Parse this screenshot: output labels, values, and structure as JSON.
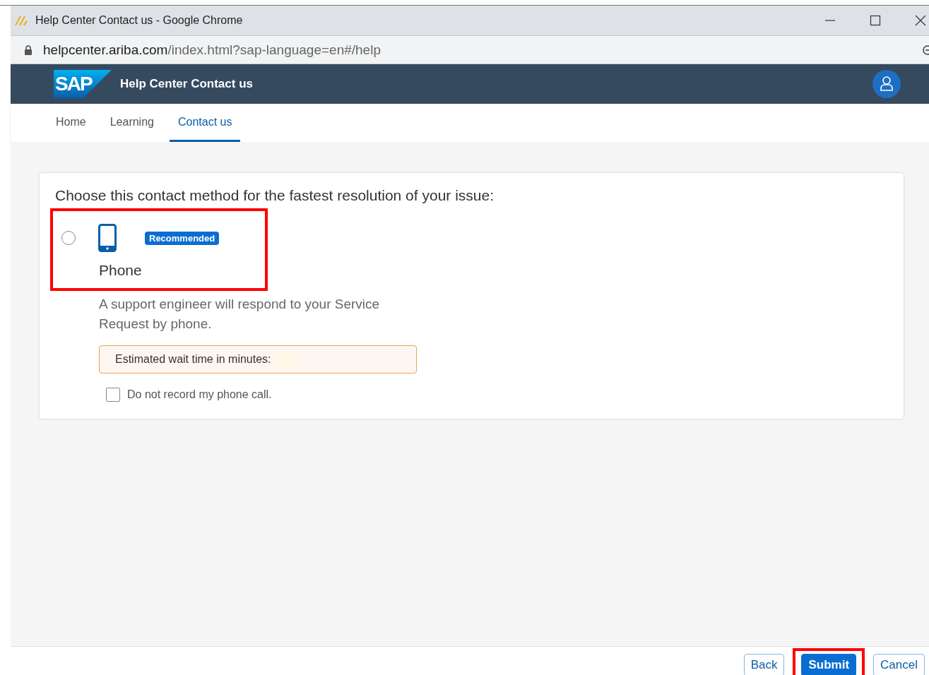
{
  "window": {
    "title": "Help Center Contact us - Google Chrome"
  },
  "address_bar": {
    "domain": "helpcenter.ariba.com",
    "path": "/index.html?sap-language=en#/help"
  },
  "header": {
    "logo": "SAP",
    "title": "Help Center Contact us"
  },
  "tabs": [
    {
      "label": "Home",
      "selected": false
    },
    {
      "label": "Learning",
      "selected": false
    },
    {
      "label": "Contact us",
      "selected": true
    }
  ],
  "card": {
    "heading": "Choose this contact method for the fastest resolution of your issue:",
    "option": {
      "selected": false,
      "highlighted": true,
      "badge": "Recommended",
      "label": "Phone",
      "description": "A support engineer will respond to your Service Request by phone.",
      "wait_label": "Estimated wait time in minutes:",
      "checkbox": {
        "label": "Do not record my phone call.",
        "checked": false
      }
    }
  },
  "footer_buttons": [
    {
      "label": "Back",
      "kind": "secondary",
      "highlighted": false
    },
    {
      "label": "Submit",
      "kind": "primary",
      "highlighted": true
    },
    {
      "label": "Cancel",
      "kind": "secondary",
      "highlighted": false
    }
  ]
}
